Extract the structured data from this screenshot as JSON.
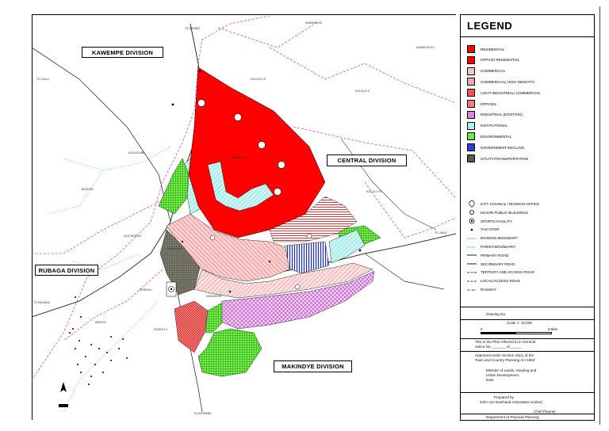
{
  "divisions": {
    "kawempe": "KAWEMPE DIVISION",
    "central": "CENTRAL DIVISION",
    "rubaga": "RUBAGA DIVISION",
    "makindye": "MAKINDYE DIVISION"
  },
  "place_labels": {
    "kamwokya": "KAMWOKYA",
    "kamwokya_1": "KAMWOKYA I",
    "kololo_3": "KOLOLO III",
    "kololo_2": "KOLOLO II",
    "kololo_4": "KOLOLO IV",
    "nakasero": "NAKASERO",
    "kagugube": "KAGUGUBE",
    "bukesa": "BUKESA",
    "old_mengo": "OLD MENGO",
    "nakivubo": "NAKIVUBO",
    "kisenyi_1": "KISENYI I",
    "kisenyi_2": "KISENYI II",
    "mengo": "MENGO",
    "nakasero_b": "NAKASERO",
    "to_jinja": "TO JINJA",
    "to_bombo": "TO BOMBO",
    "to_gulu": "TO GULU",
    "to_masaka": "TO MASAKA",
    "to_entebbe": "TO ENTEBBE"
  },
  "legend": {
    "title": "LEGEND",
    "land_use": [
      {
        "label": "RESIDENTIAL",
        "color": "#ff0000"
      },
      {
        "label": "OFFICE/ RESIDENTIAL",
        "color": "#ff0000"
      },
      {
        "label": "COMMERCIAL",
        "color": "#f7c6c6"
      },
      {
        "label": "COMMERCIAL( HIGH DENSITY)",
        "color": "#f4a6a6"
      },
      {
        "label": "LIGHT INDUSTRIAL/ COMMERCIAL",
        "color": "#ff5050"
      },
      {
        "label": "OFFICES",
        "color": "#ff7b7b"
      },
      {
        "label": "INDUSTRIAL (EXISTING)",
        "color": "#e080e8"
      },
      {
        "label": "INSTITUTIONAL",
        "color": "#a6f2f0"
      },
      {
        "label": "ENVIRONMENTAL",
        "color": "#6ee84a"
      },
      {
        "label": "GOVERNMENT ENCLAVE",
        "color": "#2a3fd8"
      },
      {
        "label": "UTILITY/TRANSPORTATION",
        "color": "#5a5a4a"
      }
    ],
    "symbols": [
      {
        "label": "CITY COUNCIL / DIVISION OFFICE",
        "icon": "pin-icon"
      },
      {
        "label": "MAJOR PUBLIC BUILDINGS",
        "icon": "circle-icon"
      },
      {
        "label": "SPORTS FACILITY",
        "icon": "target-icon"
      },
      {
        "label": "TAXI STOP",
        "icon": "dot-icon"
      },
      {
        "label": "DIVISION BOUNDARY",
        "icon": "dash-magenta-line"
      },
      {
        "label": "PARISH BOUNDARY",
        "icon": "dot-cyan-line"
      },
      {
        "label": "PRIMARY ROAD",
        "icon": "solid-line"
      },
      {
        "label": "SECONDARY ROAD",
        "icon": "solid-line"
      },
      {
        "label": "TERTIARY AND ACCESS ROAD",
        "icon": "dash-line"
      },
      {
        "label": "LOCAL/ACCESS ROAD",
        "icon": "dash-line"
      },
      {
        "label": "RAILWAY",
        "icon": "dash-dot-line"
      }
    ]
  },
  "title_block": {
    "drawing_no": "Drawing No",
    "scale": "Scale 1: 10,000",
    "scale_zero": "0",
    "scale_km": "0.5km",
    "plan_ref_1": "This is the Plan referred to in General",
    "plan_ref_2": "notice No._______ of______",
    "approved_1": "Approved under Section 16(1) of the",
    "approved_2": "Town and Country Planning Act 1964",
    "minister_1": "Minister of Lands, Housing and",
    "minister_2": "Urban Development",
    "date": "Date",
    "prepared_by": "Prepared by",
    "prepared_firm": "John von Nowhand Associates Limited",
    "chief_planner": "Chief Planner",
    "department": "Department of Physical Planning"
  },
  "map_colors": {
    "residential": "#ff0000",
    "commercial": "#f7c6c6",
    "industrial": "#e080e8",
    "environmental": "#6ee84a",
    "institutional": "#a6f2f0",
    "government": "#2a3fd8",
    "utility": "#5a5a4a",
    "division_boundary": "#e040e0",
    "parish_boundary": "#20c8e0"
  }
}
